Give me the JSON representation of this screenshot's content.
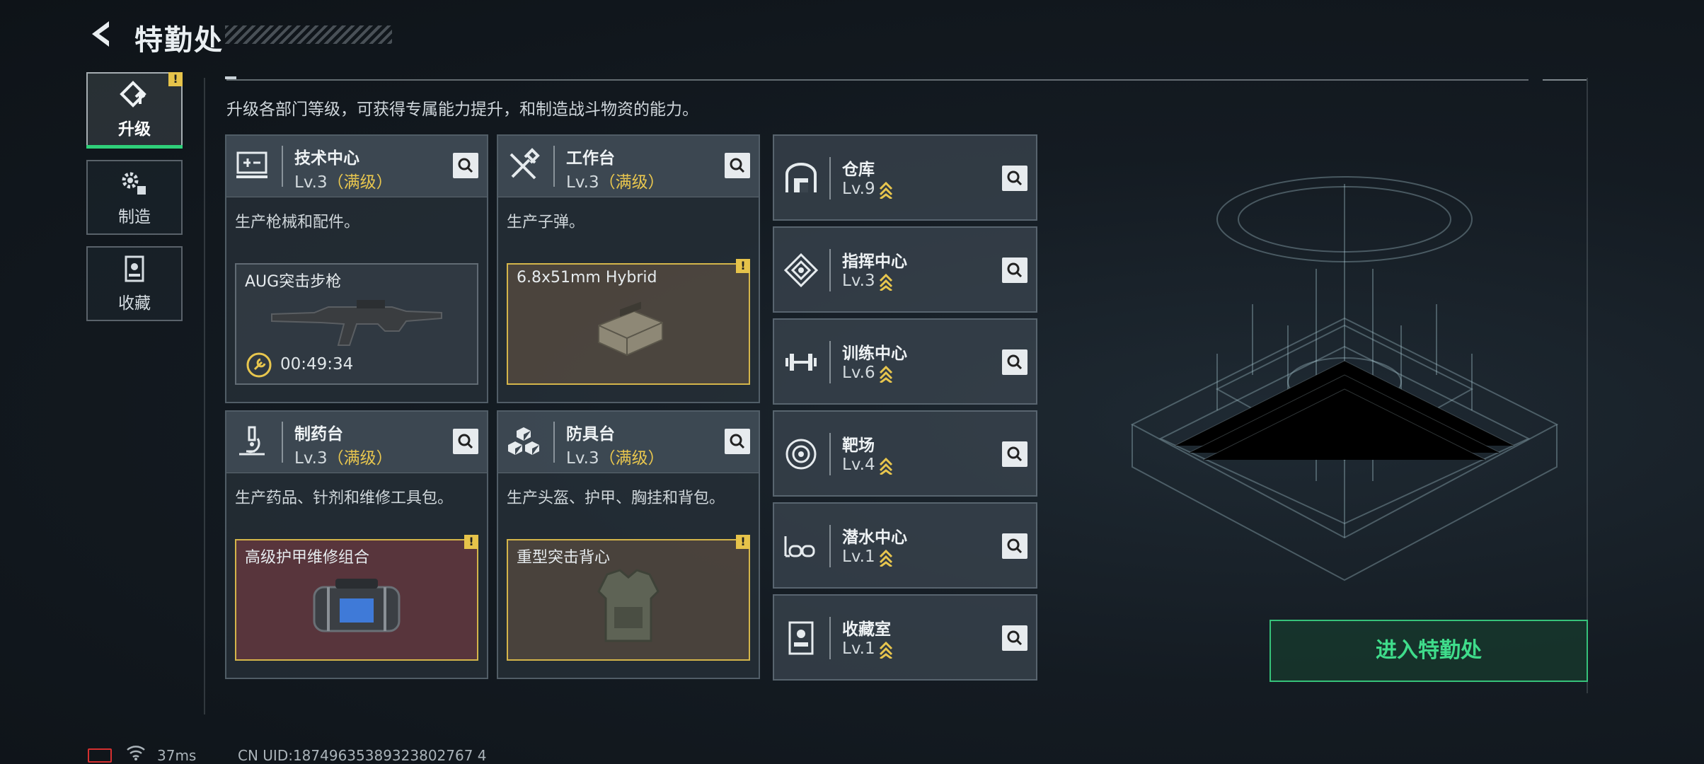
{
  "header": {
    "title": "特勤处",
    "description": "升级各部门等级，可获得专属能力提升，和制造战斗物资的能力。"
  },
  "nav": [
    {
      "label": "升级",
      "icon": "upgrade-icon",
      "active": true,
      "badge": "!"
    },
    {
      "label": "制造",
      "icon": "gears-icon",
      "active": false
    },
    {
      "label": "收藏",
      "icon": "collection-icon",
      "active": false
    }
  ],
  "cards": [
    {
      "name": "技术中心",
      "level": "Lv.3",
      "max": "（满级）",
      "desc": "生产枪械和配件。",
      "icon": "computer-icon",
      "item": {
        "name": "AUG突击步枪",
        "timer": "00:49:34"
      }
    },
    {
      "name": "工作台",
      "level": "Lv.3",
      "max": "（满级）",
      "desc": "生产子弹。",
      "icon": "tools-icon",
      "item": {
        "name": "6.8x51mm Hybrid",
        "badge": "!"
      }
    },
    {
      "name": "制药台",
      "level": "Lv.3",
      "max": "（满级）",
      "desc": "生产药品、针剂和维修工具包。",
      "icon": "microscope-icon",
      "item": {
        "name": "高级护甲维修组合",
        "badge": "!"
      }
    },
    {
      "name": "防具台",
      "level": "Lv.3",
      "max": "（满级）",
      "desc": "生产头盔、护甲、胸挂和背包。",
      "icon": "armor-blocks-icon",
      "item": {
        "name": "重型突击背心",
        "badge": "!"
      }
    }
  ],
  "facilities": [
    {
      "name": "仓库",
      "level": "Lv.9",
      "icon": "warehouse-icon"
    },
    {
      "name": "指挥中心",
      "level": "Lv.3",
      "icon": "command-icon"
    },
    {
      "name": "训练中心",
      "level": "Lv.6",
      "icon": "dumbbell-icon"
    },
    {
      "name": "靶场",
      "level": "Lv.4",
      "icon": "target-icon"
    },
    {
      "name": "潜水中心",
      "level": "Lv.1",
      "icon": "diving-mask-icon"
    },
    {
      "name": "收藏室",
      "level": "Lv.1",
      "icon": "display-case-icon"
    }
  ],
  "enter_button": "进入特勤处",
  "status": {
    "ping": "37ms",
    "uid": "CN UID:18749635389323802767 4"
  },
  "colors": {
    "accent_green": "#2fd07a",
    "gold": "#e8c64e",
    "battery_red": "#d63030"
  }
}
